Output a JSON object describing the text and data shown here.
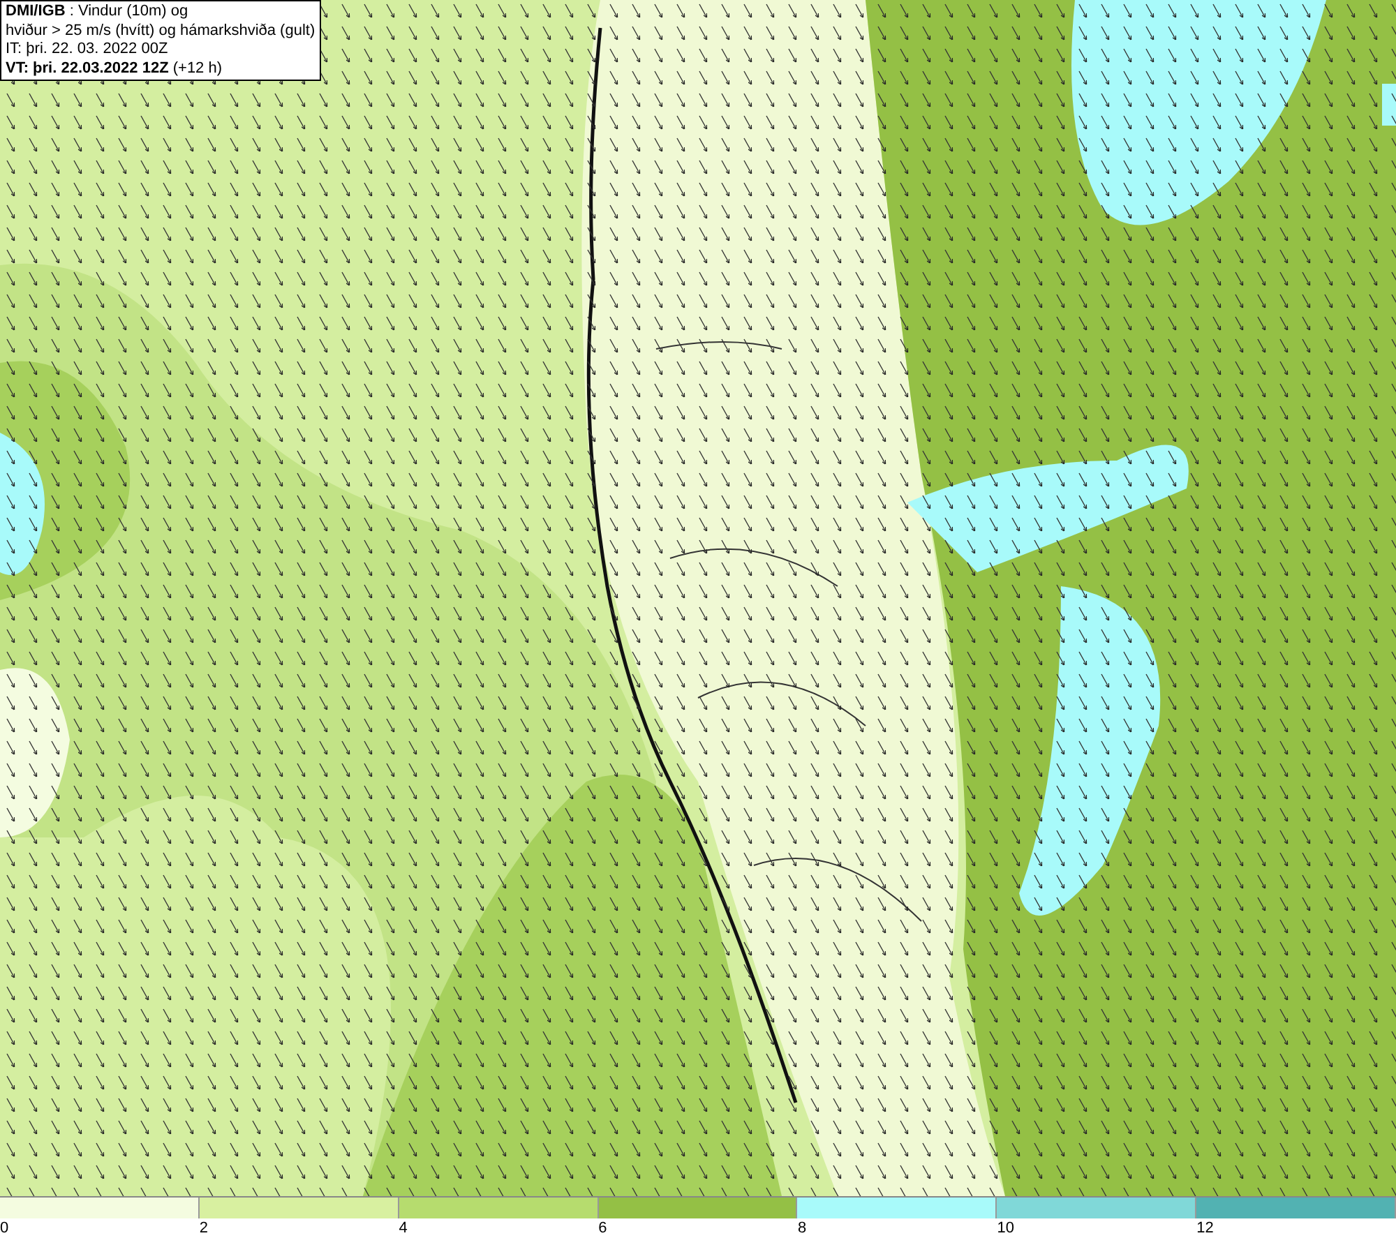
{
  "info_box": {
    "lines": [
      "**DMI/IGB** : Vindur (10m) og",
      "hviður > 25 m/s (hvítt) og hámarkshviða (gult)",
      "IT: þri. 22. 03. 2022 00Z",
      "**VT: þri. 22.03.2022 12Z** (+12 h)"
    ]
  },
  "legend": [
    {
      "label": "0",
      "color": "#f4fce0"
    },
    {
      "label": "2",
      "color": "#d8f0a0"
    },
    {
      "label": "4",
      "color": "#b6dc6e"
    },
    {
      "label": "6",
      "color": "#94c045"
    },
    {
      "label": "8",
      "color": "#a8fafa"
    },
    {
      "label": "10",
      "color": "#80d8d8"
    },
    {
      "label": "12",
      "color": "#52b2b2"
    }
  ]
}
